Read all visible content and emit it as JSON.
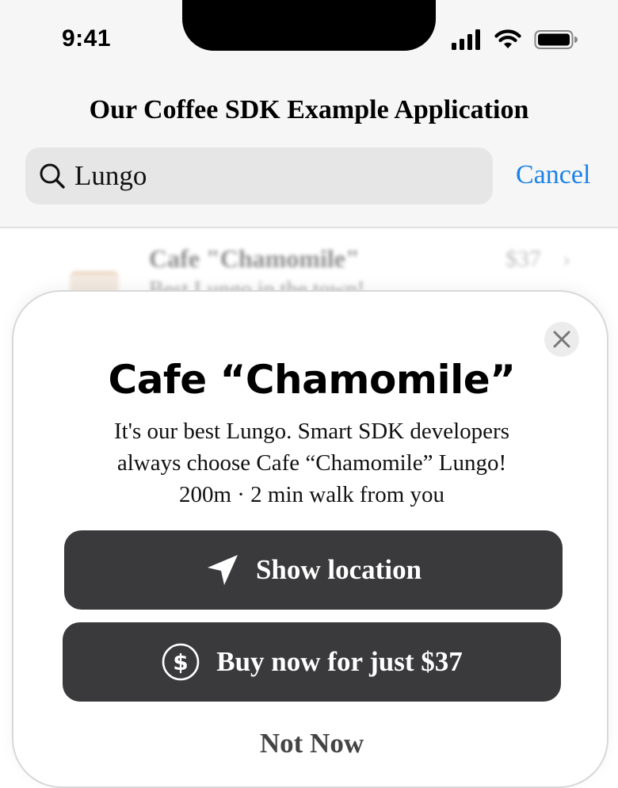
{
  "status_bar": {
    "time": "9:41"
  },
  "nav": {
    "title": "Our Coffee SDK Example Application"
  },
  "search": {
    "value": "Lungo",
    "cancel_label": "Cancel"
  },
  "background_list": {
    "title": "Cafe \"Chamomile\"",
    "subtitle": "Best Lungo in the town!",
    "price": "$37",
    "chevron": "›"
  },
  "sheet": {
    "title": "Cafe “Chamomile”",
    "description_line1": "It's our best Lungo. Smart SDK developers",
    "description_line2": "always choose Cafe “Chamomile” Lungo!",
    "description_line3": "200m · 2 min walk from you",
    "show_location_label": "Show location",
    "buy_label": "Buy now for just $37",
    "not_now_label": "Not Now"
  },
  "icons": {
    "search": "search-icon",
    "close": "close-icon",
    "location": "location-arrow-icon",
    "dollar": "dollar-circle-icon",
    "signal": "cellular-signal-icon",
    "wifi": "wifi-icon",
    "battery": "battery-icon"
  },
  "colors": {
    "accent": "#1a82e8",
    "button_bg": "#3a3a3c",
    "search_bg": "#e6e6e6",
    "header_bg": "#f6f6f6"
  }
}
